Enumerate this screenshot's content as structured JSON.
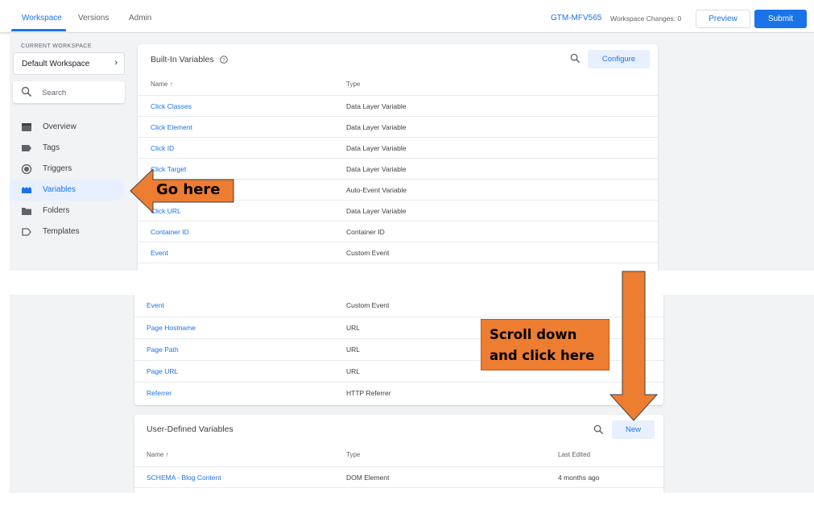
{
  "topbar": {
    "tabs": [
      "Workspace",
      "Versions",
      "Admin"
    ],
    "container_id": "GTM-MFV565",
    "workspace_changes": "Workspace Changes: 0",
    "preview_label": "Preview",
    "submit_label": "Submit"
  },
  "sidebar": {
    "current_workspace_label": "CURRENT WORKSPACE",
    "workspace_name": "Default Workspace",
    "search_placeholder": "Search",
    "items": [
      {
        "label": "Overview",
        "icon": "overview-icon",
        "active": false
      },
      {
        "label": "Tags",
        "icon": "tag-icon",
        "active": false
      },
      {
        "label": "Triggers",
        "icon": "trigger-icon",
        "active": false
      },
      {
        "label": "Variables",
        "icon": "variables-icon",
        "active": true
      },
      {
        "label": "Folders",
        "icon": "folder-icon",
        "active": false
      },
      {
        "label": "Templates",
        "icon": "template-icon",
        "active": false
      }
    ]
  },
  "builtin": {
    "title": "Built-In Variables",
    "configure_label": "Configure",
    "col_name": "Name ↑",
    "col_type": "Type",
    "rows_top": [
      {
        "name": "Click Classes",
        "type": "Data Layer Variable"
      },
      {
        "name": "Click Element",
        "type": "Data Layer Variable"
      },
      {
        "name": "Click ID",
        "type": "Data Layer Variable"
      },
      {
        "name": "Click Target",
        "type": "Data Layer Variable"
      },
      {
        "name": "",
        "type": "Auto-Event Variable"
      },
      {
        "name": "Click URL",
        "type": "Data Layer Variable"
      },
      {
        "name": "Container ID",
        "type": "Container ID"
      },
      {
        "name": "Event",
        "type": "Custom Event"
      }
    ],
    "rows_bottom": [
      {
        "name": "Event",
        "type": "Custom Event"
      },
      {
        "name": "Page Hostname",
        "type": "URL"
      },
      {
        "name": "Page Path",
        "type": "URL"
      },
      {
        "name": "Page URL",
        "type": "URL"
      },
      {
        "name": "Referrer",
        "type": "HTTP Referrer"
      }
    ]
  },
  "userdefined": {
    "title": "User-Defined Variables",
    "new_label": "New",
    "col_name": "Name ↑",
    "col_type": "Type",
    "col_edited": "Last Edited",
    "rows": [
      {
        "name": "SCHEMA - Blog Content",
        "type": "DOM Element",
        "edited": "4 months ago"
      }
    ]
  },
  "annotations": {
    "go_here": "Go here",
    "scroll_line1": "Scroll down",
    "scroll_line2": "and click here"
  },
  "colors": {
    "accent": "#1a73e8",
    "callout": "#ed7d31",
    "active_nav_bg": "#e8f0fe",
    "panel_bg": "#f1f3f4"
  }
}
